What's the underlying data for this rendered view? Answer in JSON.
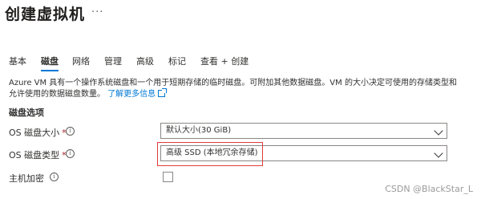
{
  "header": {
    "title": "创建虚拟机",
    "more_label": "···"
  },
  "tabs": [
    {
      "label": "基本"
    },
    {
      "label": "磁盘",
      "active": true
    },
    {
      "label": "网络"
    },
    {
      "label": "管理"
    },
    {
      "label": "高级"
    },
    {
      "label": "标记"
    },
    {
      "label": "查看 + 创建"
    }
  ],
  "description": {
    "text": "Azure VM 具有一个操作系统磁盘和一个用于短期存储的临时磁盘。可附加其他数据磁盘。VM 的大小决定可使用的存储类型和允许使用的数据磁盘数量。",
    "link_text": "了解更多信息"
  },
  "section": {
    "title": "磁盘选项"
  },
  "form": {
    "os_disk_size": {
      "label": "OS 磁盘大小",
      "required_mark": "*",
      "value": "默认大小(30 GiB)"
    },
    "os_disk_type": {
      "label": "OS 磁盘类型",
      "required_mark": "*",
      "value": "高级 SSD (本地冗余存储)"
    },
    "host_encryption": {
      "label": "主机加密",
      "checked": false
    }
  },
  "info_icon_glyph": "i",
  "watermark": "CSDN @BlackStar_L",
  "colors": {
    "accent": "#0078d4",
    "required": "#a4262c",
    "highlight_box": "#e03c3c"
  }
}
